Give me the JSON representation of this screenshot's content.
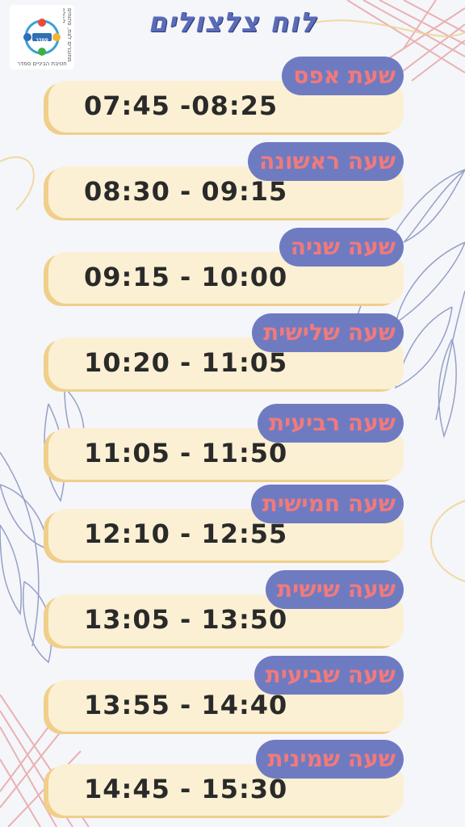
{
  "title": "לוח צלצולים",
  "logo": {
    "top_text": "מחוברים לצמ, פתוחים לעולם",
    "center_text": "סמדר",
    "bottom_text": "חטיבת הביניים סמדר"
  },
  "colors": {
    "background": "#f4f6fa",
    "pill": "#6f7bc1",
    "pill_text": "#f07a7c",
    "box": "#fbf0d3",
    "box_shadow": "#f0cf8a",
    "time_text": "#2a2a2a",
    "title": "#5b6bb8"
  },
  "schedule": [
    {
      "label": "שעת אפס",
      "time": "07:45 -08:25"
    },
    {
      "label": "שעה ראשונה",
      "time": "08:30 - 09:15"
    },
    {
      "label": "שעה שניה",
      "time": "09:15 - 10:00"
    },
    {
      "label": "שעה שלישית",
      "time": "10:20 - 11:05"
    },
    {
      "label": "שעה רביעית",
      "time": "11:05 - 11:50"
    },
    {
      "label": "שעה חמישית",
      "time": "12:10 - 12:55"
    },
    {
      "label": "שעה שישית",
      "time": "13:05 - 13:50"
    },
    {
      "label": "שעה שביעית",
      "time": "13:55 - 14:40"
    },
    {
      "label": "שעה שמינית",
      "time": "14:45 - 15:30"
    }
  ]
}
